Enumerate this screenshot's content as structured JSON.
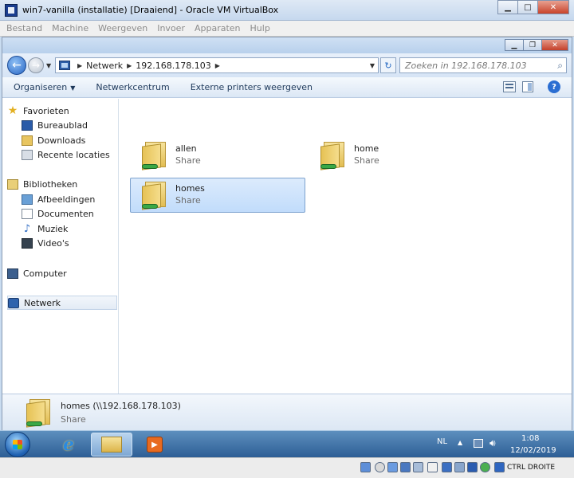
{
  "vbox": {
    "title": "win7-vanilla (installatie) [Draaiend] - Oracle VM VirtualBox",
    "menu": [
      "Bestand",
      "Machine",
      "Weergeven",
      "Invoer",
      "Apparaten",
      "Hulp"
    ],
    "host_key": "CTRL DROITE"
  },
  "explorer": {
    "address": {
      "root": "Netwerk",
      "host": "192.168.178.103"
    },
    "search_placeholder": "Zoeken in 192.168.178.103",
    "commands": {
      "organize": "Organiseren",
      "network_center": "Netwerkcentrum",
      "external_printers": "Externe printers weergeven"
    },
    "nav": {
      "favorites": "Favorieten",
      "desktop": "Bureaublad",
      "downloads": "Downloads",
      "recent": "Recente locaties",
      "libraries": "Bibliotheken",
      "pictures": "Afbeeldingen",
      "documents": "Documenten",
      "music": "Muziek",
      "videos": "Video's",
      "computer": "Computer",
      "network": "Netwerk"
    },
    "items": [
      {
        "name": "allen",
        "type": "Share"
      },
      {
        "name": "home",
        "type": "Share"
      },
      {
        "name": "homes",
        "type": "Share"
      }
    ],
    "details": {
      "name": "homes (\\\\192.168.178.103)",
      "type": "Share"
    }
  },
  "taskbar": {
    "language": "NL",
    "time": "1:08",
    "date": "12/02/2019"
  }
}
